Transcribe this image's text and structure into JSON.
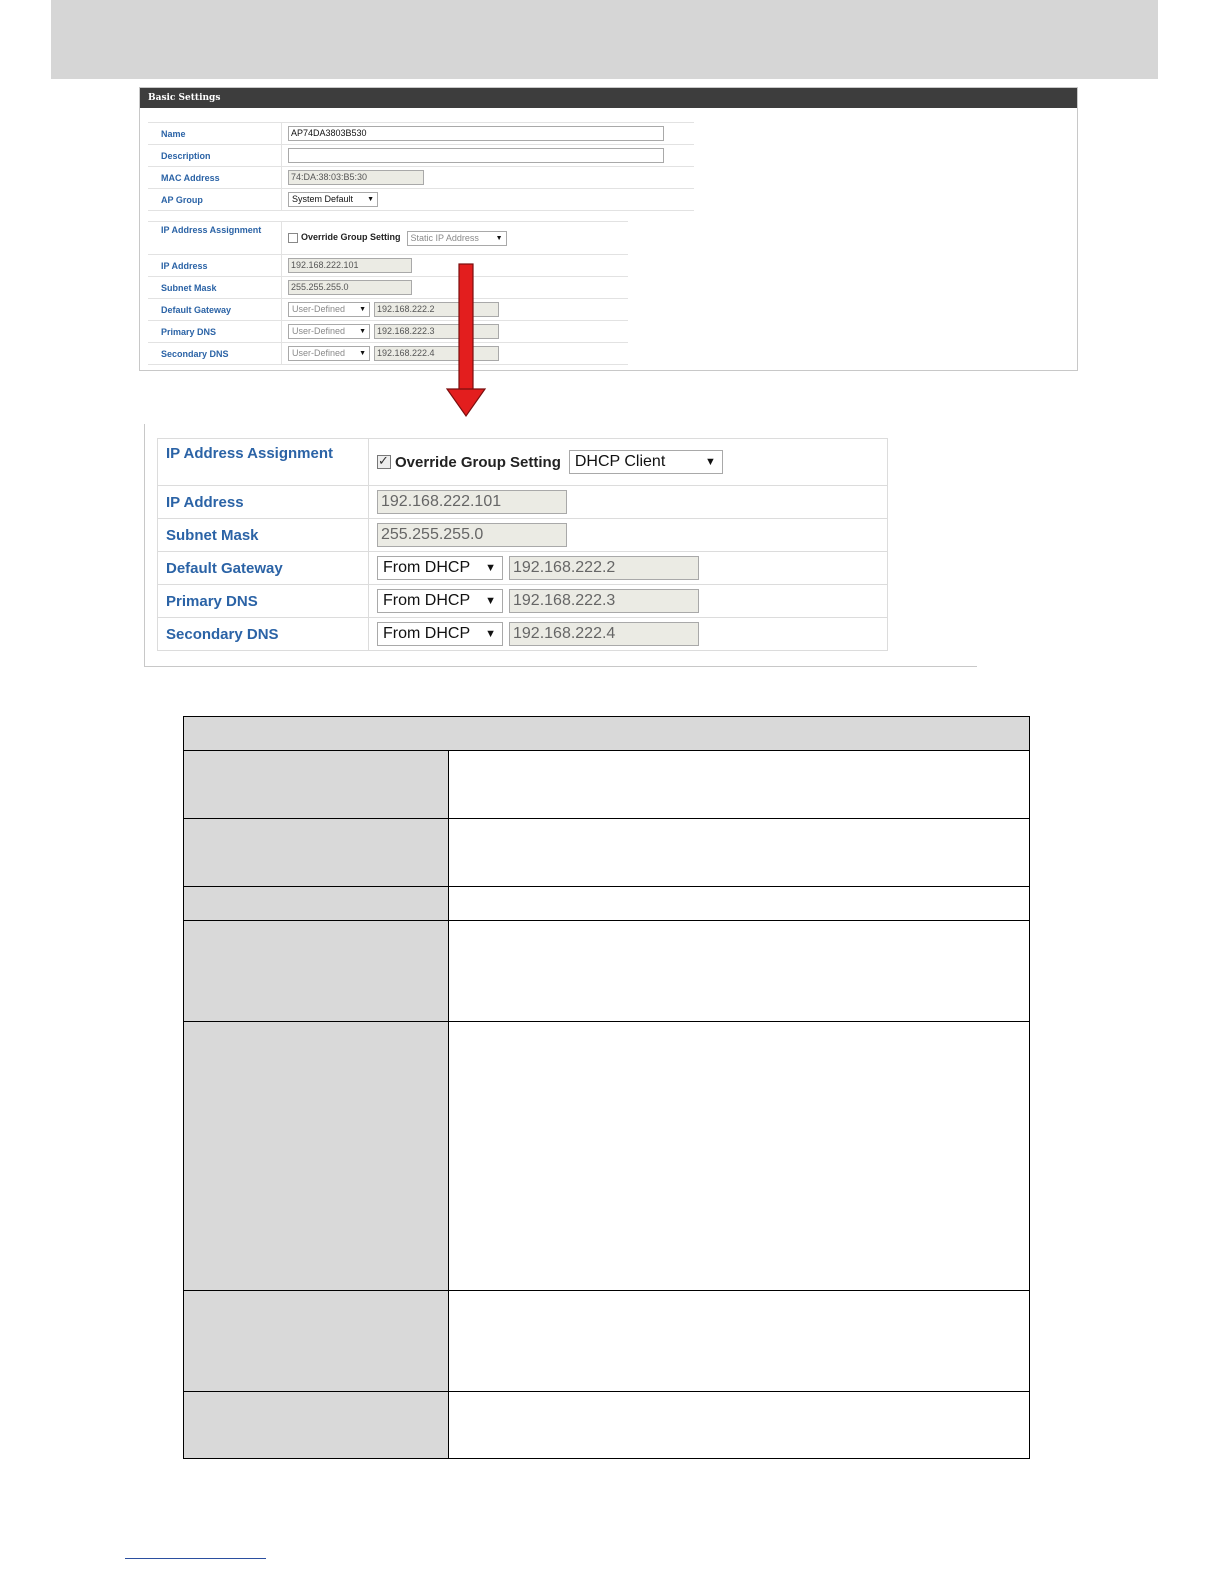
{
  "basic": {
    "title": "Basic Settings",
    "name_label": "Name",
    "name_value": "AP74DA3803B530",
    "description_label": "Description",
    "description_value": "",
    "mac_label": "MAC Address",
    "mac_value": "74:DA:38:03:B5:30",
    "apgroup_label": "AP Group",
    "apgroup_value": "System Default",
    "ipassign_label": "IP Address Assignment",
    "override_label": "Override Group Setting",
    "ipassign_value": "Static IP Address",
    "ip_label": "IP Address",
    "ip_value": "192.168.222.101",
    "subnet_label": "Subnet Mask",
    "subnet_value": "255.255.255.0",
    "gateway_label": "Default Gateway",
    "gateway_mode": "User-Defined",
    "gateway_value": "192.168.222.2",
    "pdns_label": "Primary DNS",
    "pdns_mode": "User-Defined",
    "pdns_value": "192.168.222.3",
    "sdns_label": "Secondary DNS",
    "sdns_mode": "User-Defined",
    "sdns_value": "192.168.222.4"
  },
  "zoom": {
    "ipassign_label": "IP Address Assignment",
    "override_label": "Override Group Setting",
    "override_checked": true,
    "ipassign_value": "DHCP Client",
    "ip_label": "IP Address",
    "ip_value": "192.168.222.101",
    "subnet_label": "Subnet Mask",
    "subnet_value": "255.255.255.0",
    "gateway_label": "Default Gateway",
    "gateway_mode": "From DHCP",
    "gateway_value": "192.168.222.2",
    "pdns_label": "Primary DNS",
    "pdns_mode": "From DHCP",
    "pdns_value": "192.168.222.3",
    "sdns_label": "Secondary DNS",
    "sdns_mode": "From DHCP",
    "sdns_value": "192.168.222.4"
  },
  "colors": {
    "label_blue": "#2b63a6",
    "arrow_red": "#e31e1e",
    "header_dark": "#3d3d3d",
    "table_gray": "#d9d9d9"
  }
}
